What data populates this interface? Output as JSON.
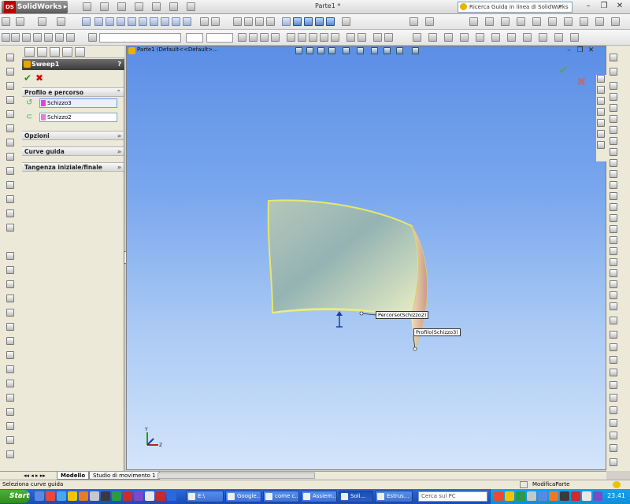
{
  "app": {
    "name": "SolidWorks",
    "badge": "DS",
    "document_title": "Parte1 *"
  },
  "help_search": {
    "placeholder": "Ricerca Guida in linea di SolidWorks"
  },
  "window_controls": {
    "minimize": "–",
    "restore": "❐",
    "close": "✕"
  },
  "property_manager": {
    "title": "Sweep1",
    "help": "?",
    "ok": "✔",
    "cancel": "✖",
    "sections": {
      "profile_path": {
        "label": "Profilo e percorso",
        "chevron": "⌃"
      },
      "options": {
        "label": "Opzioni",
        "chevron": "»"
      },
      "guide_curves": {
        "label": "Curve guida",
        "chevron": "»"
      },
      "tangency": {
        "label": "Tangenza iniziale/finale",
        "chevron": "»"
      }
    },
    "profile_value": "Schizzo3",
    "path_value": "Schizzo2"
  },
  "viewport": {
    "tree_path": "Parte1  (Default<<Default>...",
    "callouts": {
      "path": "Percorso(Schizzo2)",
      "profile": "Profilo(Schizzo3)"
    },
    "ok": "✔",
    "cancel": "✖"
  },
  "bottom_tabs": {
    "model": "Modello",
    "motion": "Studio di movimento 1"
  },
  "status": {
    "left": "Seleziona curve guida",
    "right": "ModificaParte"
  },
  "taskbar": {
    "start": "Start",
    "tasks": [
      "E:\\",
      "Google...",
      "come c...",
      "Assiem...",
      "Soli...",
      "Estrus..."
    ],
    "search_placeholder": "Cerca sul PC",
    "clock": "23.41"
  },
  "colors": {
    "viewport_top": "#5b8fe6",
    "viewport_bottom": "#d4e5fa",
    "accent": "#e044e0",
    "taskbar": "#2157c4"
  }
}
